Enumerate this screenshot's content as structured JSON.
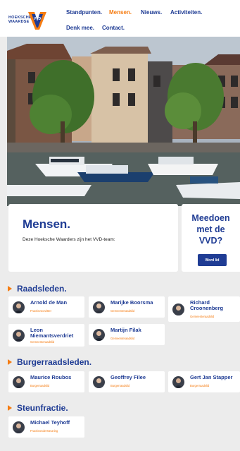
{
  "logo": {
    "text_line1": "HOEKSCHE",
    "text_line2": "WAARDSE",
    "mark": "VVD"
  },
  "nav": [
    {
      "label": "Standpunten.",
      "active": false
    },
    {
      "label": "Mensen.",
      "active": true
    },
    {
      "label": "Nieuws.",
      "active": false
    },
    {
      "label": "Activiteiten.",
      "active": false
    },
    {
      "label": "Denk mee.",
      "active": false
    },
    {
      "label": "Contact.",
      "active": false
    }
  ],
  "page": {
    "title": "Mensen.",
    "intro": "Deze Hoeksche Waarders zijn het VVD-team:"
  },
  "join": {
    "title_line1": "Meedoen",
    "title_line2": "met de",
    "title_line3": "VVD?",
    "button": "Word lid"
  },
  "sections": [
    {
      "title": "Raadsleden.",
      "people": [
        {
          "name": "Arnold de Man",
          "role": "Fractievoorzitter"
        },
        {
          "name": "Marijke Boorsma",
          "role": "Gemeenteraadslid"
        },
        {
          "name": "Richard Croonenberg",
          "role": "Gemeenteraadslid"
        },
        {
          "name": "Leon Niemantsverdriet",
          "role": "Gemeenteraadslid"
        },
        {
          "name": "Martijn Filak",
          "role": "Gemeenteraadslid"
        }
      ]
    },
    {
      "title": "Burgerraadsleden.",
      "people": [
        {
          "name": "Maurice Roubos",
          "role": "Burgerraadslid"
        },
        {
          "name": "Geoffrey Filee",
          "role": "Burgerraadslid"
        },
        {
          "name": "Gert Jan Stapper",
          "role": "Burgerraadslid"
        }
      ]
    },
    {
      "title": "Steunfractie.",
      "people": [
        {
          "name": "Michael Teyhoff",
          "role": "Fractieondersteuning"
        }
      ]
    }
  ],
  "colors": {
    "brand_blue": "#1f3c94",
    "accent_orange": "#f57c12",
    "background": "#ececec"
  }
}
